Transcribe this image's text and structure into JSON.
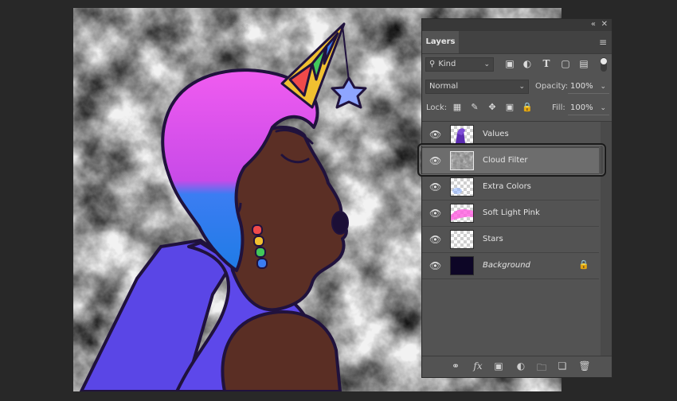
{
  "panel": {
    "title": "Layers",
    "collapse_icon": "double-chevron-icon",
    "close_icon": "close-icon",
    "menu_icon": "panel-menu-icon"
  },
  "filter": {
    "kind_label": "Kind",
    "icons": [
      "image-filter-icon",
      "adjustment-filter-icon",
      "type-filter-icon",
      "shape-filter-icon",
      "smart-object-filter-icon"
    ],
    "toggle_on": true
  },
  "blend": {
    "mode": "Normal",
    "opacity_label": "Opacity:",
    "opacity_value": "100%"
  },
  "lock": {
    "label": "Lock:",
    "icons": [
      "lock-transparent-icon",
      "lock-paint-icon",
      "lock-position-icon",
      "lock-artboard-icon",
      "lock-all-icon"
    ],
    "fill_label": "Fill:",
    "fill_value": "100%"
  },
  "layers": [
    {
      "name": "Values",
      "visible": true,
      "selected": false,
      "thumb": "values"
    },
    {
      "name": "Cloud Filter",
      "visible": true,
      "selected": true,
      "thumb": "clouds"
    },
    {
      "name": "Extra Colors",
      "visible": true,
      "selected": false,
      "thumb": "extra"
    },
    {
      "name": "Soft Light Pink",
      "visible": true,
      "selected": false,
      "thumb": "pink"
    },
    {
      "name": "Stars",
      "visible": true,
      "selected": false,
      "thumb": "transparent"
    },
    {
      "name": "Background",
      "visible": true,
      "selected": false,
      "thumb": "dark",
      "locked": true,
      "italic": true
    }
  ],
  "footer_icons": [
    "link-layers-icon",
    "fx-icon",
    "mask-icon",
    "adjustment-layer-icon",
    "group-folder-icon",
    "new-layer-icon",
    "trash-icon"
  ],
  "colors": {
    "panel_bg": "#535353",
    "selected_row": "#6d6d6d",
    "app_bg": "#282828"
  }
}
